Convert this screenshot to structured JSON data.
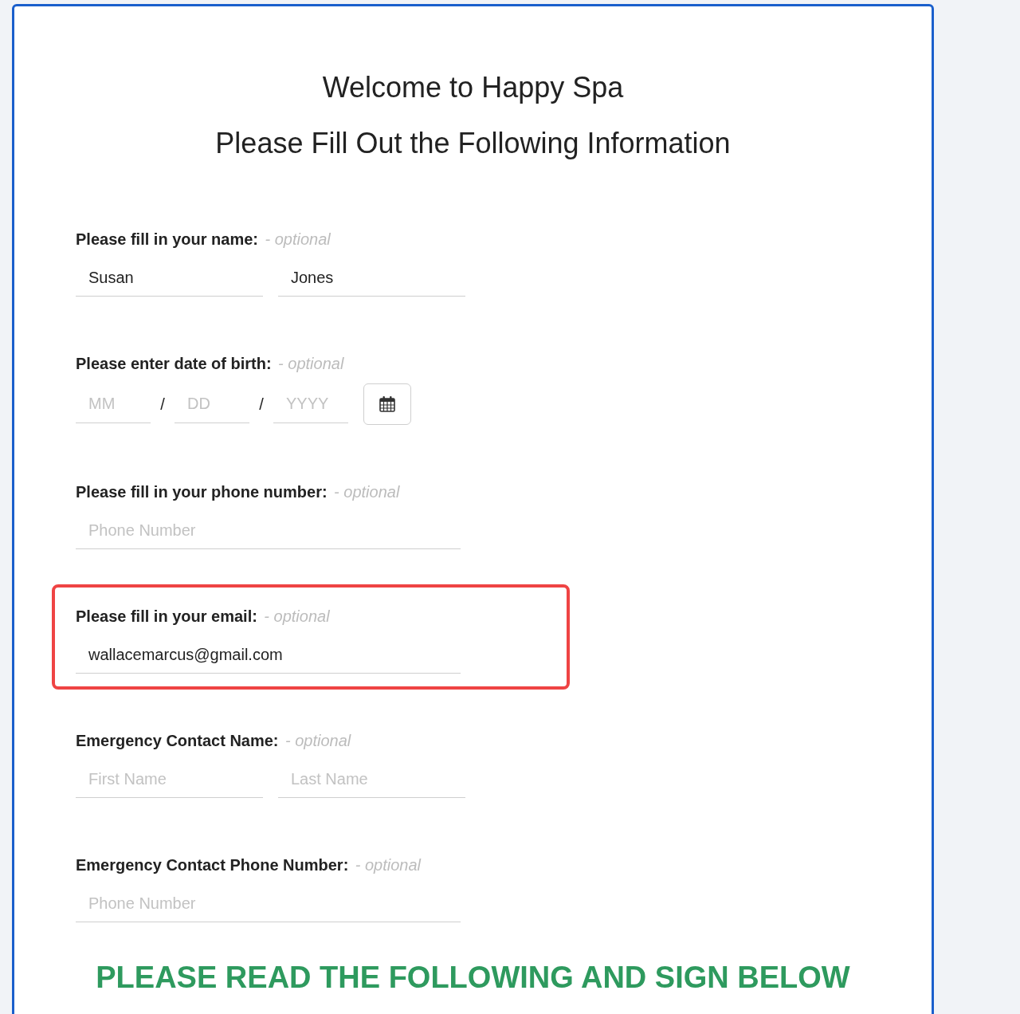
{
  "titles": [
    "Welcome to Happy Spa",
    "Please Fill Out the Following Information"
  ],
  "sections": [
    {
      "kind": "pair",
      "label": "Please fill in your name:",
      "note": "- optional",
      "highlighted": false,
      "inputs": [
        {
          "value": "Susan"
        },
        {
          "value": "Jones"
        }
      ]
    },
    {
      "kind": "date",
      "label": "Please enter date of birth:",
      "note": "- optional",
      "highlighted": false,
      "inputs": [
        {
          "placeholder": "MM"
        },
        {
          "placeholder": "DD"
        },
        {
          "placeholder": "YYYY"
        }
      ],
      "separators": [
        "/",
        "/"
      ]
    },
    {
      "kind": "single",
      "label": "Please fill in your phone number:",
      "note": "- optional",
      "highlighted": false,
      "inputs": [
        {
          "placeholder": "Phone Number"
        }
      ]
    },
    {
      "kind": "single",
      "label": "Please fill in your email:",
      "note": "- optional",
      "highlighted": true,
      "inputs": [
        {
          "value": "wallacemarcus@gmail.com"
        }
      ]
    },
    {
      "kind": "pair",
      "label": "Emergency Contact Name:",
      "note": "- optional",
      "highlighted": false,
      "inputs": [
        {
          "placeholder": "First Name"
        },
        {
          "placeholder": "Last Name"
        }
      ]
    },
    {
      "kind": "single",
      "label": "Emergency Contact Phone Number:",
      "note": "- optional",
      "highlighted": false,
      "inputs": [
        {
          "placeholder": "Phone Number"
        }
      ]
    }
  ],
  "heading": "PLEASE READ THE FOLLOWING AND SIGN BELOW"
}
